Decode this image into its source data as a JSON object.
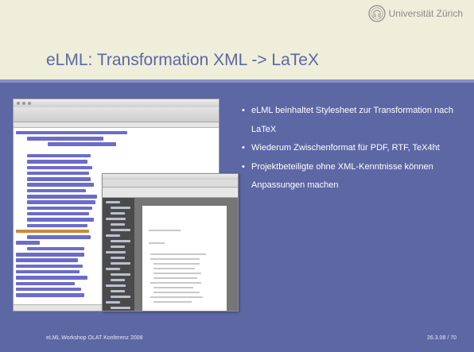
{
  "header": {
    "university": "Universität Zürich",
    "title": "eLML: Transformation XML -> LaTeX"
  },
  "bullets": [
    "eLML beinhaltet Stylesheet zur Transformation nach LaTeX",
    "Wiederum Zwischenformat für PDF, RTF, TeX4ht",
    "Projektbeteiligte ohne XML-Kenntnisse können Anpassungen machen"
  ],
  "footer": {
    "left": "eLML Workshop OLAT Konferenz 2008",
    "right": "26.3.08  /  70"
  },
  "colors": {
    "background": "#5c67a4",
    "header": "#eeeeda",
    "title": "#5c67a4",
    "text": "#ffffff"
  }
}
